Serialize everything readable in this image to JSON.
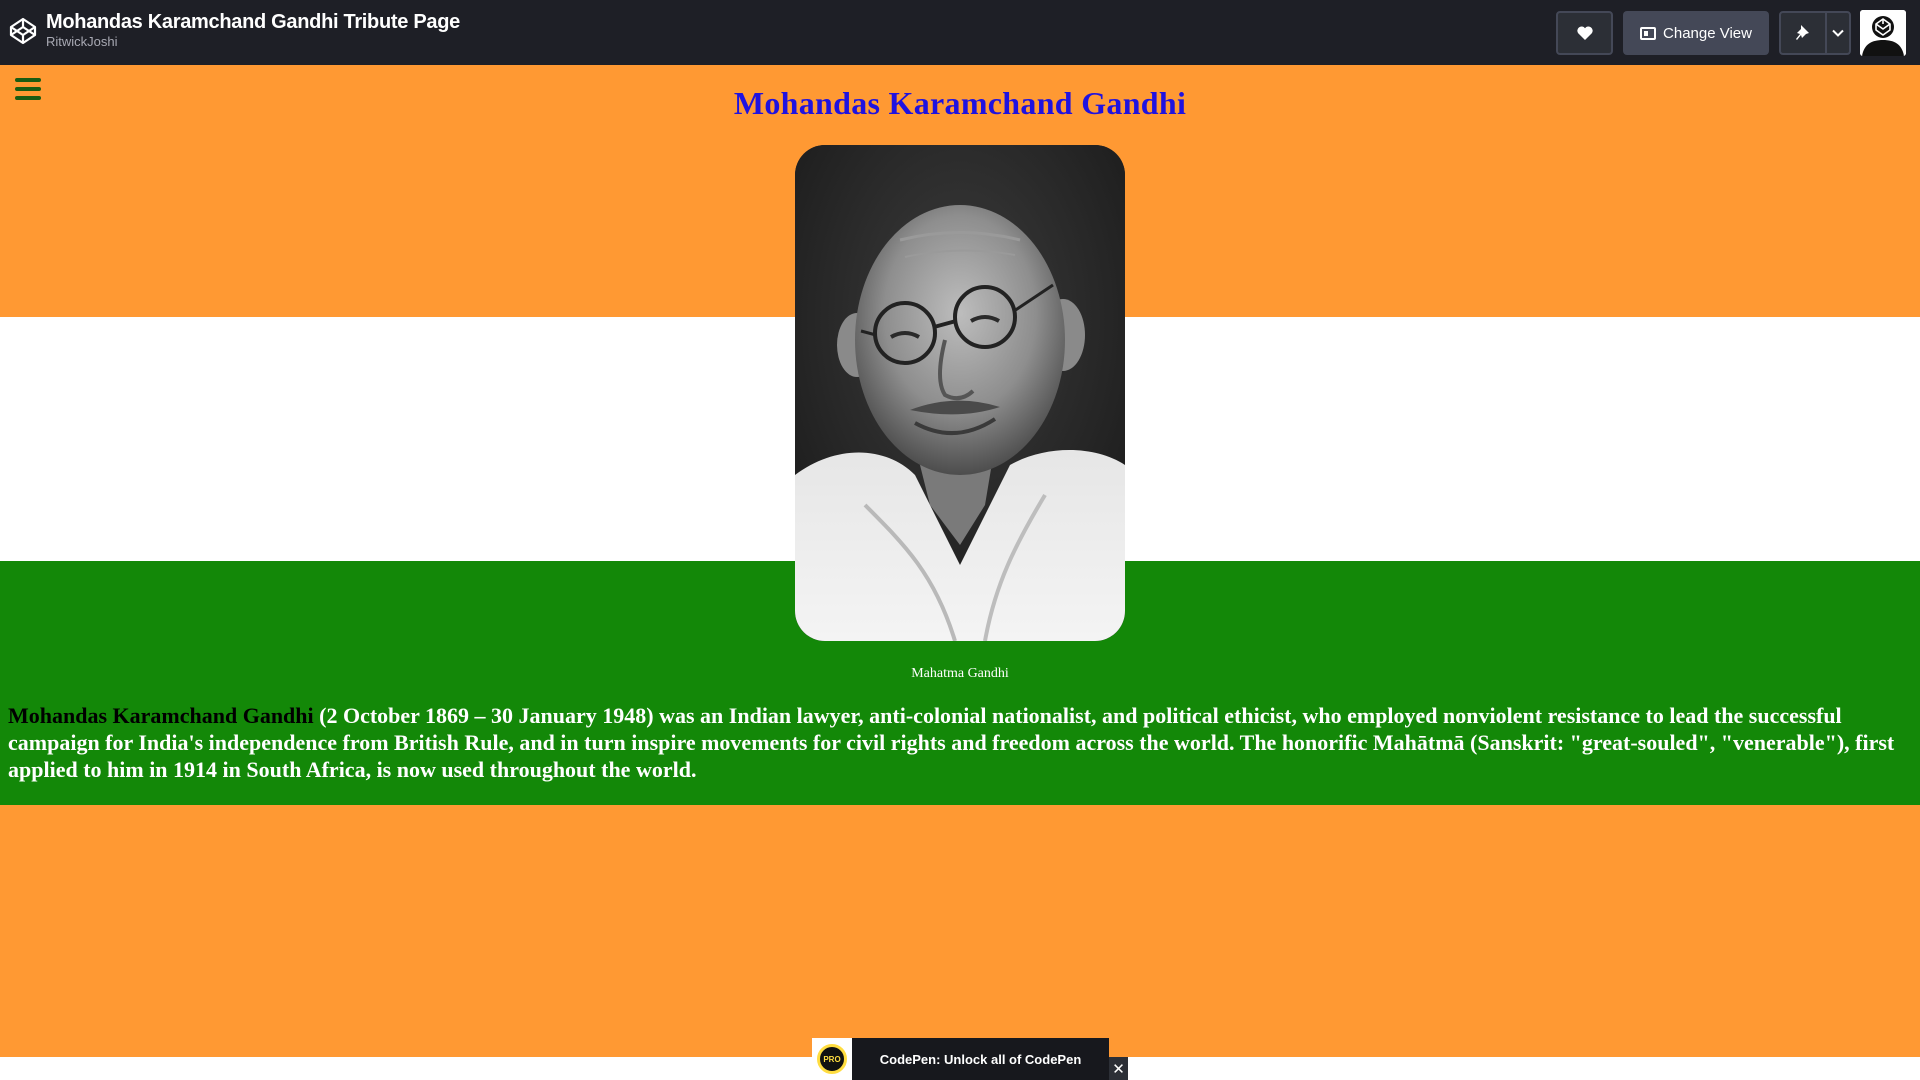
{
  "codepen": {
    "pen_title": "Mohandas Karamchand Gandhi Tribute Page",
    "author": "RitwickJoshi",
    "change_view_label": "Change View",
    "icons": {
      "logo": "codepen-logo-icon",
      "heart": "heart-icon",
      "view": "layout-icon",
      "pin": "pin-icon",
      "chevron": "chevron-down-icon",
      "avatar": "user-avatar"
    }
  },
  "tribute": {
    "title": "Mohandas Karamchand Gandhi",
    "image_caption": "Mahatma Gandhi",
    "bio_name": "Mohandas Karamchand Gandhi",
    "bio_text": " (2 October 1869 – 30 January 1948) was an Indian lawyer, anti-colonial nationalist, and political ethicist, who employed nonviolent resistance to lead the successful campaign for India's independence from British Rule, and in turn inspire movements for civil rights and freedom across the world. The honorific Mahātmā (Sanskrit: \"great-souled\", \"venerable\"), first applied to him in 1914 in South Africa, is now used throughout the world.",
    "colors": {
      "saffron": "#ff9933",
      "white": "#ffffff",
      "green": "#138808",
      "title": "#1f12e0"
    }
  },
  "promo": {
    "badge": "PRO",
    "text": "CodePen: Unlock all of CodePen",
    "close": "✕"
  }
}
